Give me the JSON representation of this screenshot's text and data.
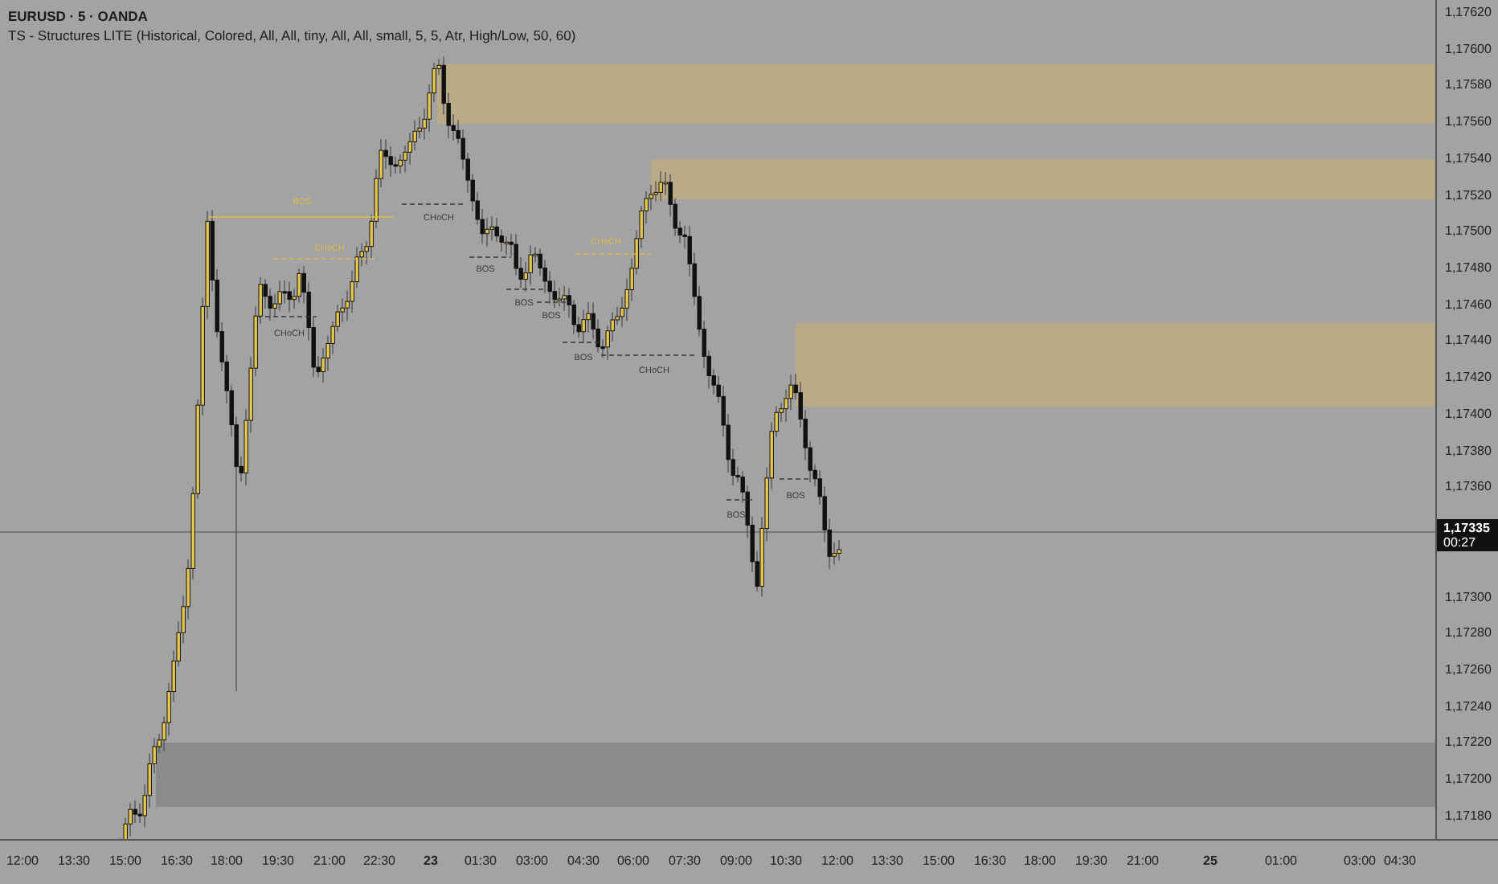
{
  "header": {
    "symbol": "EURUSD · 5 · OANDA",
    "indicator": "TS - Structures LITE (Historical, Colored, All, All, tiny, All, All, small, 5, 5, Atr, High/Low, 50, 60)"
  },
  "zones": [
    {
      "color": "#b9ab88"
    },
    {
      "color": "#b9ab88"
    },
    {
      "color": "#b9ab88"
    },
    {
      "color": "#8b8b8b"
    }
  ],
  "structure_labels": [
    {
      "text": "BOS",
      "color": "#dcbc48"
    },
    {
      "text": "CHoCH",
      "color": "#dcbc48"
    },
    {
      "text": "CHoCH",
      "color": "#3a3a3a"
    },
    {
      "text": "CHoCH",
      "color": "#3a3a3a"
    },
    {
      "text": "BOS",
      "color": "#3a3a3a"
    },
    {
      "text": "BOS",
      "color": "#3a3a3a"
    },
    {
      "text": "BOS",
      "color": "#3a3a3a"
    },
    {
      "text": "CHoCH",
      "color": "#dcbc48"
    },
    {
      "text": "BOS",
      "color": "#3a3a3a"
    },
    {
      "text": "CHoCH",
      "color": "#3a3a3a"
    },
    {
      "text": "BOS",
      "color": "#3a3a3a"
    },
    {
      "text": "BOS",
      "color": "#3a3a3a"
    }
  ],
  "price_axis": [
    "1,17620",
    "1,17600",
    "1,17580",
    "1,17560",
    "1,17540",
    "1,17520",
    "1,17500",
    "1,17480",
    "1,17460",
    "1,17440",
    "1,17420",
    "1,17400",
    "1,17380",
    "1,17360",
    "1,17300",
    "1,17280",
    "1,17260",
    "1,17240",
    "1,17220",
    "1,17200",
    "1,17180"
  ],
  "current_price": {
    "price": "1,17335",
    "countdown": "00:27"
  },
  "time_axis": [
    {
      "label": "12:00",
      "kind": "time"
    },
    {
      "label": "13:30",
      "kind": "time"
    },
    {
      "label": "15:00",
      "kind": "time"
    },
    {
      "label": "16:30",
      "kind": "time"
    },
    {
      "label": "18:00",
      "kind": "time"
    },
    {
      "label": "19:30",
      "kind": "time"
    },
    {
      "label": "21:00",
      "kind": "time"
    },
    {
      "label": "22:30",
      "kind": "time"
    },
    {
      "label": "23",
      "kind": "day"
    },
    {
      "label": "01:30",
      "kind": "time"
    },
    {
      "label": "03:00",
      "kind": "time"
    },
    {
      "label": "04:30",
      "kind": "time"
    },
    {
      "label": "06:00",
      "kind": "time"
    },
    {
      "label": "07:30",
      "kind": "time"
    },
    {
      "label": "09:00",
      "kind": "time"
    },
    {
      "label": "10:30",
      "kind": "time"
    },
    {
      "label": "12:00",
      "kind": "time"
    },
    {
      "label": "13:30",
      "kind": "time"
    },
    {
      "label": "15:00",
      "kind": "time"
    },
    {
      "label": "16:30",
      "kind": "time"
    },
    {
      "label": "18:00",
      "kind": "time"
    },
    {
      "label": "19:30",
      "kind": "time"
    },
    {
      "label": "21:00",
      "kind": "time"
    },
    {
      "label": "25",
      "kind": "day"
    },
    {
      "label": "01:00",
      "kind": "time"
    },
    {
      "label": "03:00",
      "kind": "time"
    },
    {
      "label": "04:30",
      "kind": "time"
    }
  ]
}
